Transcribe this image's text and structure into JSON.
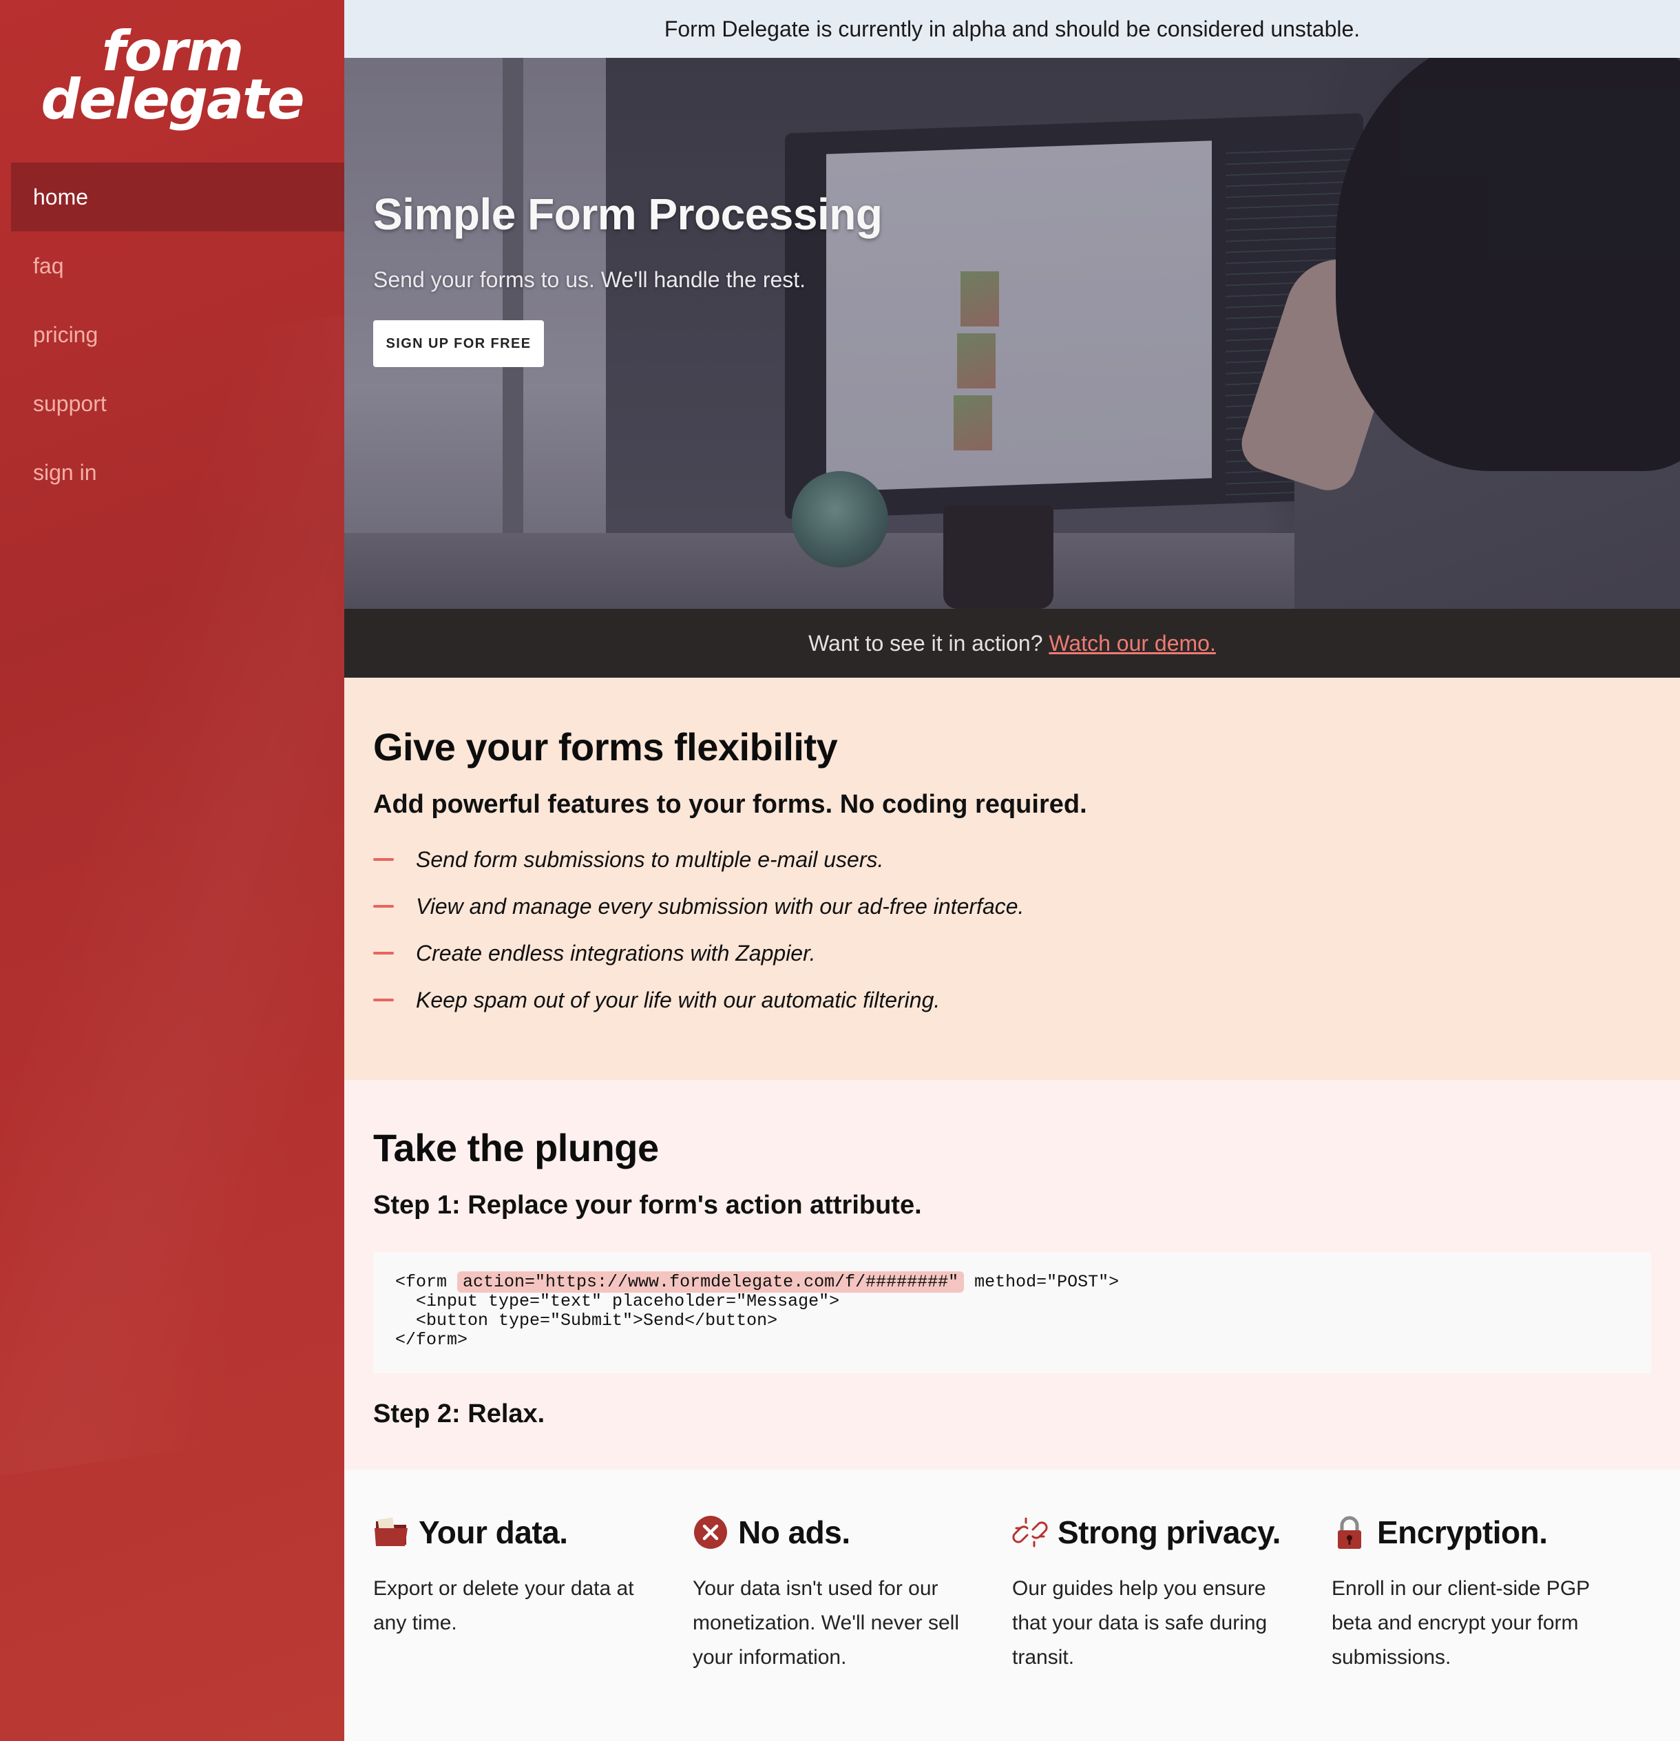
{
  "banner": {
    "text": "Form Delegate is currently in alpha and should be considered unstable."
  },
  "sidebar": {
    "logo_line1": "form",
    "logo_line2": "delegate",
    "items": [
      {
        "label": "home",
        "active": true
      },
      {
        "label": "faq"
      },
      {
        "label": "pricing"
      },
      {
        "label": "support"
      },
      {
        "label": "sign in"
      }
    ]
  },
  "hero": {
    "title": "Simple Form Processing",
    "subtitle": "Send your forms to us. We'll handle the rest.",
    "cta_label": "SIGN UP FOR FREE"
  },
  "demo": {
    "prompt": "Want to see it in action?",
    "link_label": "Watch our demo."
  },
  "features": {
    "heading": "Give your forms flexibility",
    "subheading": "Add powerful features to your forms. No coding required.",
    "items": [
      "Send form submissions to multiple e-mail users.",
      "View and manage every submission with our ad-free interface.",
      "Create endless integrations with Zappier.",
      "Keep spam out of your life with our automatic filtering."
    ]
  },
  "plunge": {
    "heading": "Take the plunge",
    "step1": "Step 1: Replace your form's action attribute.",
    "code": {
      "line1_pre": "<form ",
      "line1_hl": "action=\"https://www.formdelegate.com/f/########\"",
      "line1_post": " method=\"POST\">",
      "line2": "  <input type=\"text\" placeholder=\"Message\">",
      "line3": "  <button type=\"Submit\">Send</button>",
      "line4": "</form>"
    },
    "step2": "Step 2: Relax."
  },
  "benefits": [
    {
      "icon": "folder-icon",
      "title": "Your data.",
      "text": "Export or delete your data at any time."
    },
    {
      "icon": "no-entry-icon",
      "title": "No ads.",
      "text": "Your data isn't used for our monetization. We'll never sell your information."
    },
    {
      "icon": "broken-link-icon",
      "title": "Strong privacy.",
      "text": "Our guides help you ensure that your data is safe during transit."
    },
    {
      "icon": "lock-icon",
      "title": "Encryption.",
      "text": "Enroll in our client-side PGP beta and encrypt your form submissions."
    }
  ],
  "colors": {
    "sidebar": "#b12f2e",
    "sidebar_active": "#8f2426",
    "nav_text": "#f3b0a7",
    "banner_bg": "#e6ecf4",
    "demo_bar_bg": "#2b2727",
    "link_accent": "#ef7a73",
    "features_bg": "#fbe6d8",
    "plunge_bg": "#fef0ef",
    "code_highlight": "#f4c5c0"
  }
}
